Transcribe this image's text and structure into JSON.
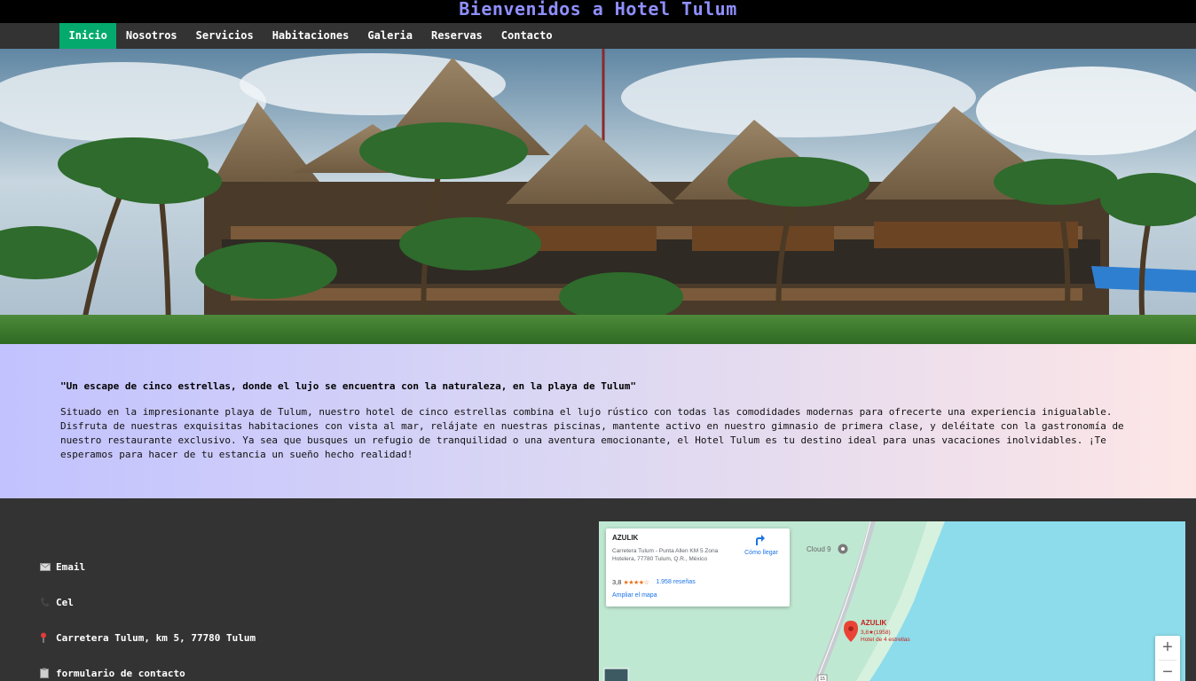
{
  "header": {
    "title": "Bienvenidos a Hotel Tulum"
  },
  "nav": {
    "items": [
      {
        "label": "Inicio",
        "active": true
      },
      {
        "label": "Nosotros"
      },
      {
        "label": "Servicios"
      },
      {
        "label": "Habitaciones"
      },
      {
        "label": "Galeria"
      },
      {
        "label": "Reservas"
      },
      {
        "label": "Contacto"
      }
    ]
  },
  "intro": {
    "slogan": "\"Un escape de cinco estrellas, donde el lujo se encuentra con la naturaleza, en la playa de Tulum\"",
    "description": "Situado en la impresionante playa de Tulum, nuestro hotel de cinco estrellas combina el lujo rústico con todas las comodidades modernas para ofrecerte una experiencia inigualable. Disfruta de nuestras exquisitas habitaciones con vista al mar, relájate en nuestras piscinas, mantente activo en nuestro gimnasio de primera clase, y deléitate con la gastronomía de nuestro restaurante exclusivo. Ya sea que busques un refugio de tranquilidad o una aventura emocionante, el Hotel Tulum es tu destino ideal para unas vacaciones inolvidables. ¡Te esperamos para hacer de tu estancia un sueño hecho realidad!"
  },
  "contact": {
    "email": "Email",
    "phone": "Cel",
    "address": "Carretera Tulum, km 5, 77780 Tulum",
    "form": "formulario de contacto"
  },
  "map": {
    "place_name": "AZULIK",
    "place_address": "Carretera Tulum - Punta Allen KM 5 Zona Hotelera, 77780 Tulum, Q.R., México",
    "directions": "Cómo llegar",
    "rating": "3,8",
    "stars": "★★★★☆",
    "reviews": "1.958 reseñas",
    "enlarge": "Ampliar el mapa",
    "poi_cloud9": "Cloud 9",
    "marker_name": "AZULIK",
    "marker_rating": "3,8★(1958)",
    "marker_category": "Hotel de 4 estrellas",
    "road_number": "15",
    "zoom_in": "+",
    "zoom_out": "−"
  },
  "colors": {
    "title": "#8f8fff",
    "nav_bg": "#333333",
    "nav_active": "#04aa6d",
    "map_sea": "#8cdcec",
    "map_land": "#bfe8d2"
  }
}
